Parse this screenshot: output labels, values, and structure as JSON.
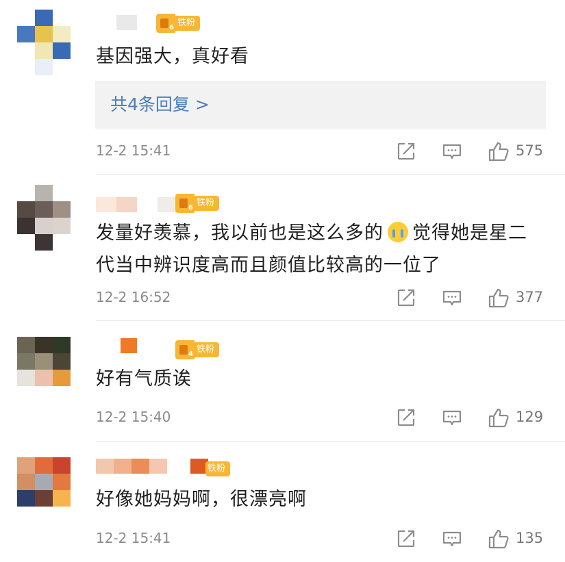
{
  "badge_label": "铁粉",
  "comments": [
    {
      "badge_level": "6",
      "text": "基因强大，真好看",
      "replies_label": "共4条回复 >",
      "time": "12-2 15:41",
      "likes": "575",
      "avatar_colors": [
        "#ffffff",
        "#3a6ab5",
        "#ffffff",
        "#4a78bf",
        "#e8c24e",
        "#f3ecc0",
        "#ffffff",
        "#f0e7b5",
        "#3a6ab5",
        "#ffffff",
        "#e9eff8",
        "#ffffff"
      ],
      "name_colors": [
        "#ffffff",
        "#e9e9e9",
        "#ffffff",
        "#f0f0f0"
      ]
    },
    {
      "badge_level": "6",
      "text_before_emoji": "发量好羡慕，我以前也是这么多的",
      "emoji": "crying-face",
      "text_after_emoji": "觉得她是星二代当中辨识度高而且颜值比较高的一位了",
      "time": "12-2 16:52",
      "likes": "377",
      "avatar_colors": [
        "#ffffff",
        "#b9b3ae",
        "#ffffff",
        "#574a45",
        "#6b5d58",
        "#9e8f87",
        "#3c3232",
        "#d7d0cc",
        "#dad4cd",
        "#ffffff",
        "#3d3433",
        "#ffffff"
      ],
      "name_colors": [
        "#fbe7dc",
        "#f5d5c5",
        "#ffffff",
        "#f0ece8"
      ]
    },
    {
      "badge_level": "4",
      "text": "好有气质诶",
      "time": "12-2 15:40",
      "likes": "129",
      "avatar_colors": [
        "#6b6353",
        "#3a3328",
        "#2f3a26",
        "#7b7765",
        "#9a8f78",
        "#4c4434",
        "#e6e2dc",
        "#ecc0ac",
        "#e79a3a",
        "#ffffff",
        "#ffffff",
        "#ffffff"
      ],
      "name_colors": [
        "#ffffff",
        "#ef7a26",
        "#ffffff",
        "#ffffff"
      ]
    },
    {
      "badge_level": "",
      "text": "好像她妈妈啊，很漂亮啊",
      "time": "12-2 15:41",
      "likes": "135",
      "avatar_colors": [
        "#e1a27a",
        "#e26b3c",
        "#c9432d",
        "#d18f63",
        "#a9aab1",
        "#e3793e",
        "#2d3e6b",
        "#6d3f34",
        "#f5b54c",
        "#ffffff",
        "#ffffff",
        "#ffffff"
      ],
      "name_colors": [
        "#f3c7ad",
        "#f1b18d",
        "#ec8c5b",
        "#f6c7b0",
        "#ffffff",
        "#de5a22"
      ]
    }
  ]
}
